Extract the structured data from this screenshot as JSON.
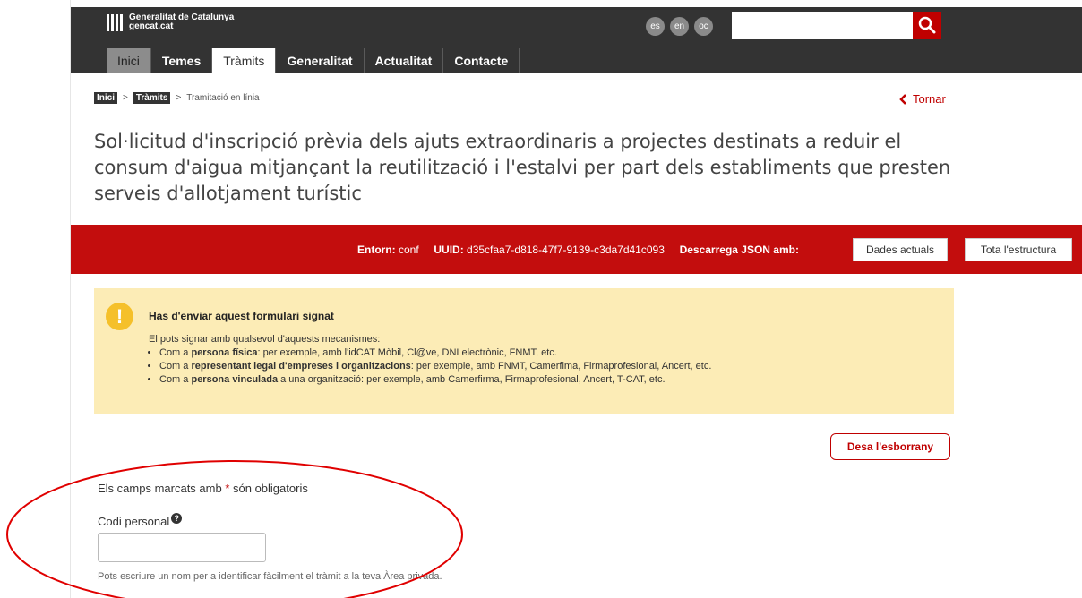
{
  "header": {
    "logo_line1": "Generalitat de Catalunya",
    "logo_line2": "gencat.cat",
    "languages": [
      "es",
      "en",
      "oc"
    ],
    "search_value": "",
    "search_icon": "search-icon"
  },
  "nav": [
    "Inici",
    "Temes",
    "Tràmits",
    "Generalitat",
    "Actualitat",
    "Contacte"
  ],
  "breadcrumb": {
    "items": [
      "Inici",
      "Tràmits"
    ],
    "sep": ">",
    "current": "Tramitació en línia"
  },
  "back_label": "Tornar",
  "title": "Sol·licitud d'inscripció prèvia dels ajuts extraordinaris a projectes destinats a reduir el consum d'aigua mitjançant la reutilització i l'estalvi per part dels establiments que presten serveis d'allotjament turístic",
  "env": {
    "entorn_label": "Entorn:",
    "entorn_value": "conf",
    "uuid_label": "UUID:",
    "uuid_value": "d35cfaa7-d818-47f7-9139-c3da7d41c093",
    "download_label": "Descarrega JSON amb:",
    "btn_current": "Dades actuals",
    "btn_structure": "Tota l'estructura"
  },
  "warning": {
    "icon": "!",
    "title": "Has d'enviar aquest formulari signat",
    "intro": "El pots signar amb qualsevol d'aquests mecanismes:",
    "items": [
      {
        "pre": "Com a ",
        "bold": "persona física",
        "post": ": per exemple, amb l'idCAT Mòbil, Cl@ve, DNI electrònic, FNMT, etc."
      },
      {
        "pre": "Com a ",
        "bold": "representant legal d'empreses i organitzacions",
        "post": ": per exemple, amb FNMT, Camerfima, Firmaprofesional, Ancert, etc."
      },
      {
        "pre": "Com a ",
        "bold": "persona vinculada",
        "post": " a una organització: per exemple, amb Camerfirma, Firmaprofesional, Ancert, T-CAT, etc."
      }
    ]
  },
  "draft_button": "Desa l'esborrany",
  "form": {
    "required_pre": "Els camps marcats amb ",
    "required_star": "*",
    "required_post": " són obligatoris",
    "code_label": "Codi personal",
    "help_glyph": "?",
    "code_value": "",
    "code_help": "Pots escriure un nom per a identificar fàcilment el tràmit a la teva Àrea privada."
  },
  "colors": {
    "header_bg": "#333333",
    "brand_red": "#c30d0d",
    "warning_bg": "#fcecb6",
    "warning_icon": "#f5c02a",
    "annotation": "#e00000"
  }
}
